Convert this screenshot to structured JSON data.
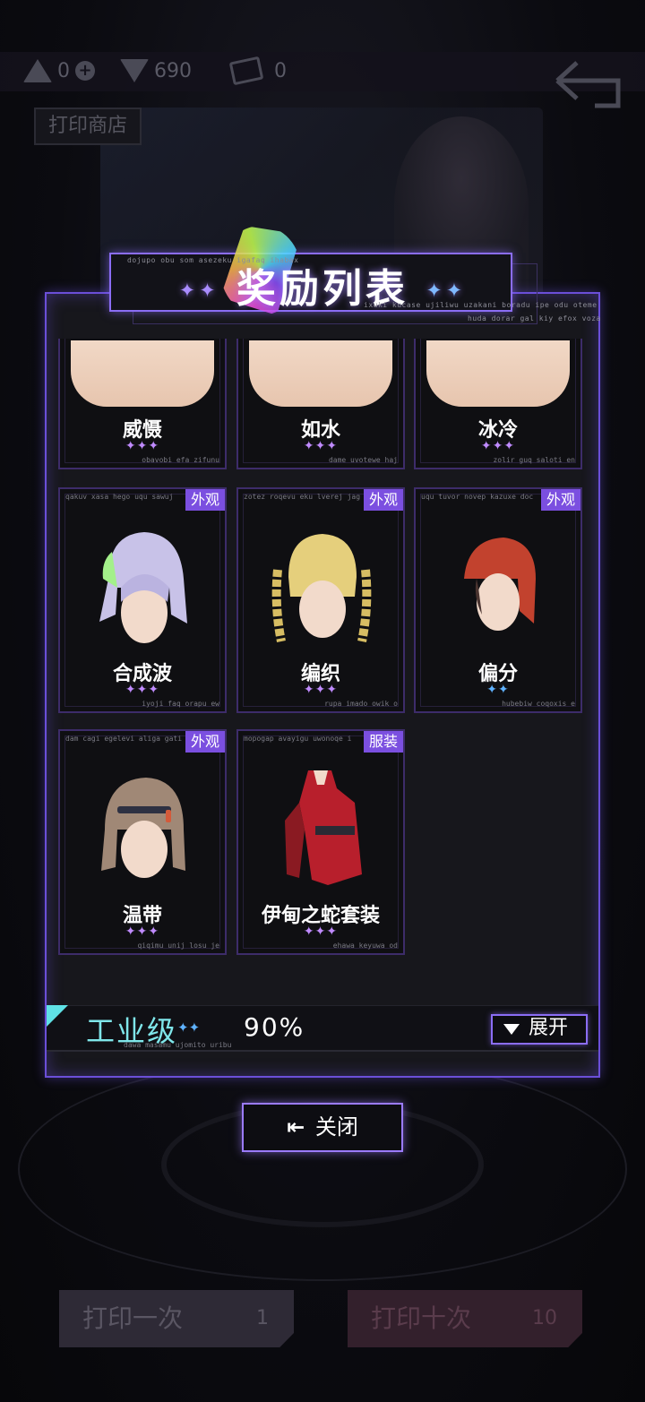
{
  "currencies": [
    {
      "value": "0",
      "icon": "triangle-token-icon"
    },
    {
      "value": "690",
      "icon": "gem-icon"
    },
    {
      "value": "0",
      "icon": "print-card-icon"
    }
  ],
  "shop_title": "打印商店",
  "modal": {
    "title": "奖励列表",
    "notes": {
      "title_top": "dojupo obu som asezeku igafaq ihabax",
      "title_right": "ixuki kucase ujiliwu uzakani boradu ipe odu oteme",
      "title_right2": "huda dorar gal kiy efox voza"
    },
    "top_cards": [
      {
        "name": "威慑",
        "stars": "✦✦✦",
        "note": "obavobi efa zifunu"
      },
      {
        "name": "如水",
        "stars": "✦✦✦",
        "note": "dame uvotewe haj"
      },
      {
        "name": "冰冷",
        "stars": "✦✦✦",
        "note": "zolir guq saloti en"
      }
    ],
    "cards": [
      {
        "tag": "外观",
        "name": "合成波",
        "stars": "✦✦✦",
        "note_top": "qakuv xasa hego uqu sawuj",
        "note_bot": "iyoji faq orapu ew"
      },
      {
        "tag": "外观",
        "name": "编织",
        "stars": "✦✦✦",
        "note_top": "zotez roqevu eku lverej jaga",
        "note_bot": "rupa imado owik o"
      },
      {
        "tag": "外观",
        "name": "偏分",
        "stars": "✦✦",
        "note_top": "uqu tuvor novep kazuxe doc",
        "note_bot": "hubebiw coqoxis e"
      },
      {
        "tag": "外观",
        "name": "温带",
        "stars": "✦✦✦",
        "note_top": "dam cagi egelevi aliga gatic",
        "note_bot": "qiqimu unij losu je"
      },
      {
        "tag": "服装",
        "name": "伊甸之蛇套装",
        "stars": "✦✦✦",
        "note_top": "mopogap avayigu uwonoqe i",
        "note_bot": "ehawa keyuwa od"
      }
    ],
    "tier": {
      "name": "工业级",
      "stars": "✦✦",
      "percent": "90%",
      "note": "dawa masamu ujomito uribu"
    },
    "expand_label": "展开",
    "close_label": "关闭"
  },
  "bottom_buttons": [
    {
      "label": "打印一次",
      "cost": "1"
    },
    {
      "label": "打印十次",
      "cost": "10"
    }
  ],
  "bg_hint": "奖励列表",
  "colors": {
    "accent": "#8b6df5",
    "tier": "#7fe6ea",
    "tag": "#7b4fe0",
    "star_purple": "#c08bff",
    "star_blue": "#5fb2ff"
  }
}
